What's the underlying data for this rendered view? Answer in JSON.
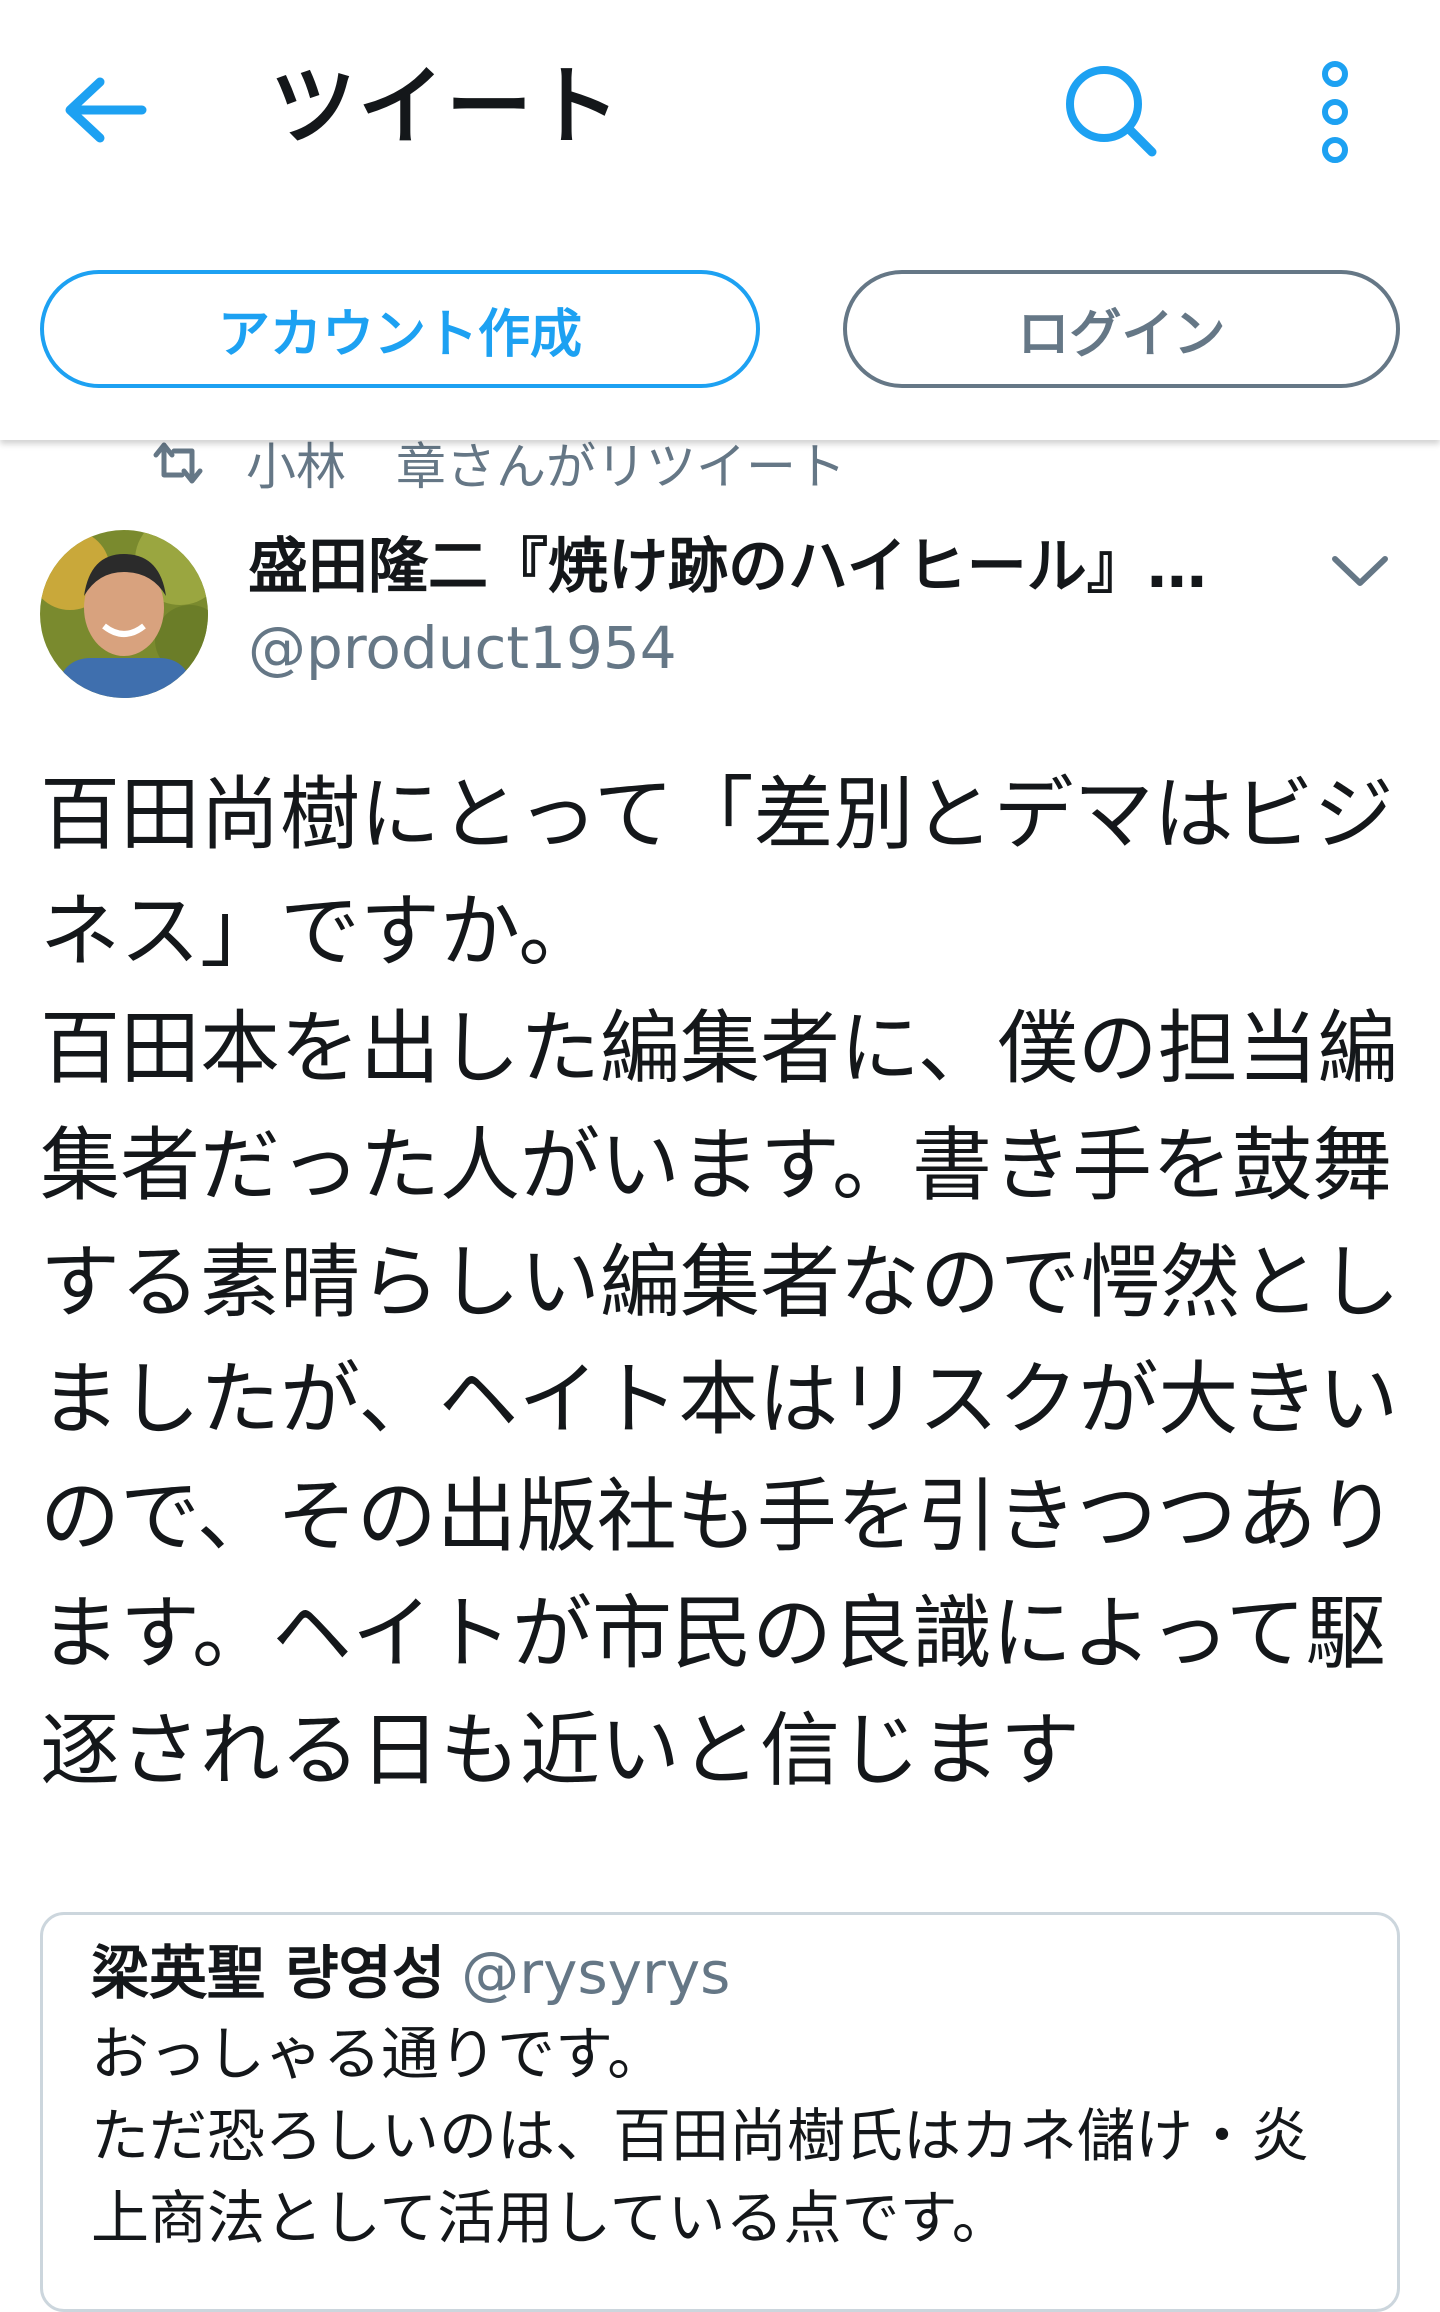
{
  "header": {
    "title": "ツイート",
    "back_icon": "arrow-left-icon",
    "search_icon": "search-icon",
    "more_icon": "more-vertical-icon",
    "accent_color": "#1da1f2"
  },
  "actions": {
    "signup_label": "アカウント作成",
    "login_label": "ログイン"
  },
  "retweet": {
    "icon": "retweet-icon",
    "text": "小林　章さんがリツイート"
  },
  "tweet": {
    "author_name": "盛田隆二『焼け跡のハイヒール』好評発売中",
    "author_handle": "@product1954",
    "text": "百田尚樹にとって「差別とデマはビジネス」ですか。\n百田本を出した編集者に、僕の担当編集者だった人がいます。書き手を鼓舞する素晴らしい編集者なので愕然としましたが、ヘイト本はリスクが大きいので、その出版社も手を引きつつあります。ヘイトが市民の良識によって駆逐される日も近いと信じます"
  },
  "quoted_tweet": {
    "author_name": "梁英聖 량영성",
    "author_handle": "@rysyrys",
    "text": "おっしゃる通りです。\nただ恐ろしいのは、百田尚樹氏はカネ儲け・炎上商法として活用している点です。"
  }
}
